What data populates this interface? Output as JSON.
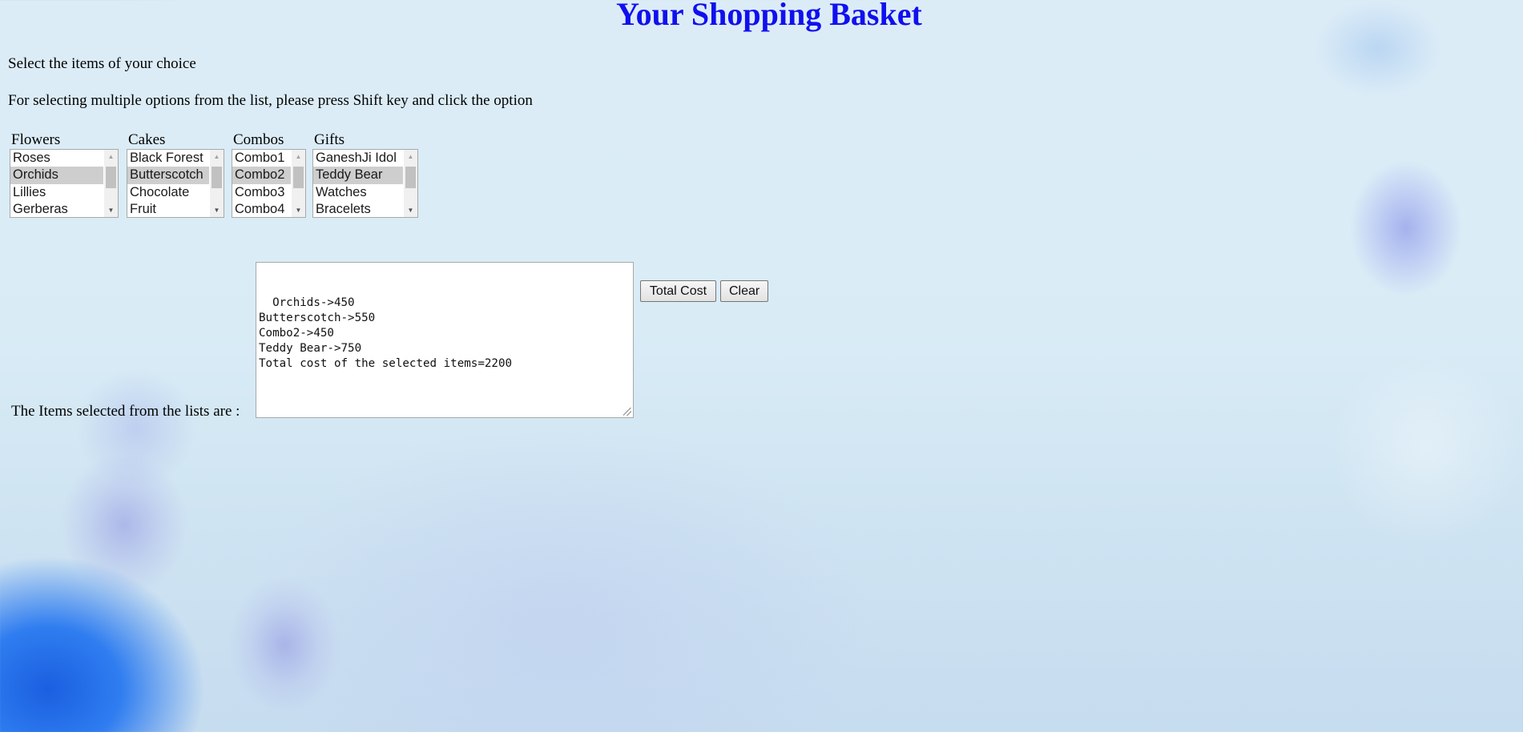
{
  "header": {
    "title": "Your Shopping Basket"
  },
  "instructions": {
    "line1": "Select the items of your choice",
    "line2": "For selecting multiple options from the list, please press Shift key and click the option"
  },
  "lists": [
    {
      "label": "Flowers",
      "options": [
        "Roses",
        "Orchids",
        "Lillies",
        "Gerberas"
      ],
      "selected": [
        "Orchids"
      ]
    },
    {
      "label": "Cakes",
      "options": [
        "Black Forest",
        "Butterscotch",
        "Chocolate",
        "Fruit"
      ],
      "selected": [
        "Butterscotch"
      ]
    },
    {
      "label": "Combos",
      "options": [
        "Combo1",
        "Combo2",
        "Combo3",
        "Combo4"
      ],
      "selected": [
        "Combo2"
      ]
    },
    {
      "label": "Gifts",
      "options": [
        "GaneshJi Idol",
        "Teddy Bear",
        "Watches",
        "Bracelets"
      ],
      "selected": [
        "Teddy Bear"
      ]
    }
  ],
  "result": {
    "label": "The Items selected from the lists are :",
    "text": "Orchids->450\nButterscotch->550\nCombo2->450\nTeddy Bear->750\nTotal cost of the selected items=2200"
  },
  "buttons": {
    "total_cost": "Total Cost",
    "clear": "Clear"
  },
  "icons": {
    "scroll_up": "triangle-up-icon",
    "scroll_down": "triangle-down-icon",
    "resize_grip": "resize-grip-icon"
  },
  "colors": {
    "title": "#1010ee",
    "selected_option_bg": "#cecece",
    "background": "#d9ecf6"
  }
}
